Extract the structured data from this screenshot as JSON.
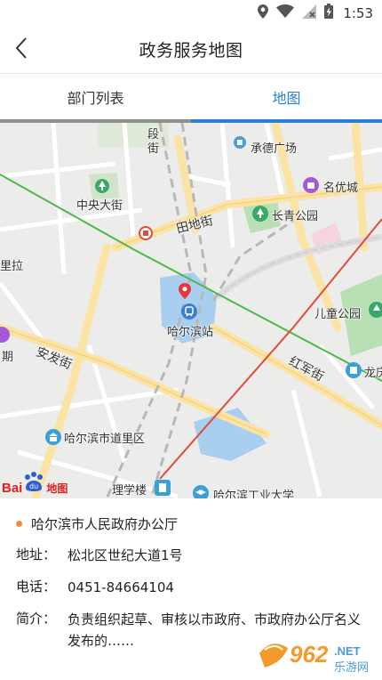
{
  "status": {
    "time": "1:53",
    "icons": [
      "location-icon",
      "wifi-icon",
      "no-signal-icon",
      "battery-charging-icon"
    ]
  },
  "header": {
    "title": "政务服务地图",
    "back_icon": "chevron-left-icon"
  },
  "tabs": [
    {
      "label": "部门列表",
      "active": false
    },
    {
      "label": "地图",
      "active": true
    }
  ],
  "map": {
    "labels": {
      "duan_jie": "段\n街",
      "chengde": "承德广场",
      "zhongyang": "中央大街",
      "mingyou": "名优城",
      "tiandi": "田地街",
      "changqing": "长青公园",
      "lila": "里拉",
      "ertong": "儿童公园",
      "anfa": "安发街",
      "harbin_station": "哈尔滨站",
      "hongjun": "红军街",
      "longfu": "龙庆",
      "qi": "期",
      "shidao": "哈尔滨市道里区",
      "lixue": "理学楼",
      "gongye": "哈尔滨工业大学"
    },
    "logo_text": "Bai",
    "logo_suffix": "地图"
  },
  "office": {
    "name": "哈尔滨市人民政府办公厅",
    "address_label": "地址：",
    "address": "松北区世纪大道1号",
    "phone_label": "电话：",
    "phone": "0451-84664104",
    "intro_label": "简介：",
    "intro": "负责组织起草、审核以市政府、市政府办公厅名义发布的……"
  },
  "watermark": {
    "text": "962",
    "suffix": ".NET",
    "sub": "乐游网"
  },
  "colors": {
    "accent": "#2d7fd3",
    "dot": "#f08a3c",
    "road_major": "#fbe3a5",
    "water": "#a8cff0",
    "park": "#b9dfb5",
    "rail_green": "#4cb84c",
    "rail_red": "#e04a3c"
  }
}
